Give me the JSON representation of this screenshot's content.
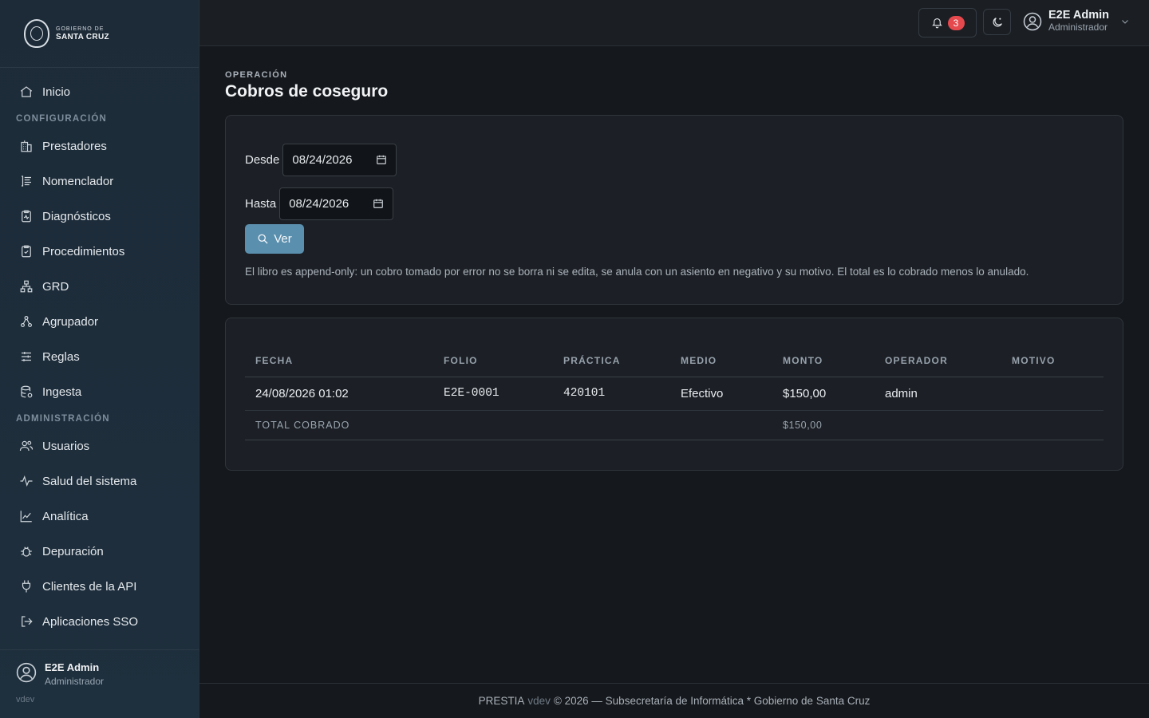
{
  "brand": {
    "line1": "GOBIERNO DE",
    "line2": "SANTA CRUZ"
  },
  "sidebar": {
    "home": {
      "label": "Inicio",
      "icon": "house-icon"
    },
    "config_title": "CONFIGURACIÓN",
    "config_items": [
      {
        "label": "Prestadores",
        "icon": "building-icon"
      },
      {
        "label": "Nomenclador",
        "icon": "list-icon"
      },
      {
        "label": "Diagnósticos",
        "icon": "clipboard-pulse-icon"
      },
      {
        "label": "Procedimientos",
        "icon": "clipboard-check-icon"
      },
      {
        "label": "GRD",
        "icon": "network-icon"
      },
      {
        "label": "Agrupador",
        "icon": "hierarchy-icon"
      },
      {
        "label": "Reglas",
        "icon": "sliders-icon"
      },
      {
        "label": "Ingesta",
        "icon": "database-icon"
      }
    ],
    "admin_title": "ADMINISTRACIÓN",
    "admin_items": [
      {
        "label": "Usuarios",
        "icon": "users-icon"
      },
      {
        "label": "Salud del sistema",
        "icon": "activity-icon"
      },
      {
        "label": "Analítica",
        "icon": "chart-line-icon"
      },
      {
        "label": "Depuración",
        "icon": "bug-icon"
      },
      {
        "label": "Clientes de la API",
        "icon": "plug-icon"
      },
      {
        "label": "Aplicaciones SSO",
        "icon": "login-icon"
      }
    ],
    "user": {
      "name": "E2E Admin",
      "role": "Administrador"
    },
    "version": "vdev"
  },
  "topbar": {
    "notifications_count": "3",
    "user": {
      "name": "E2E Admin",
      "role": "Administrador"
    }
  },
  "page": {
    "eyebrow": "OPERACIÓN",
    "title": "Cobros de coseguro"
  },
  "filters": {
    "desde_label": "Desde",
    "desde_value": "08/24/2026",
    "hasta_label": "Hasta",
    "hasta_value": "08/24/2026",
    "ver_label": "Ver",
    "note": "El libro es append-only: un cobro tomado por error no se borra ni se edita, se anula con un asiento en negativo y su motivo. El total es lo cobrado menos lo anulado."
  },
  "table": {
    "headers": [
      "FECHA",
      "FOLIO",
      "PRÁCTICA",
      "MEDIO",
      "MONTO",
      "OPERADOR",
      "MOTIVO"
    ],
    "rows": [
      {
        "fecha": "24/08/2026 01:02",
        "folio": "E2E-0001",
        "practica": "420101",
        "medio": "Efectivo",
        "monto": "$150,00",
        "operador": "admin",
        "motivo": ""
      }
    ],
    "total_label": "TOTAL COBRADO",
    "total_value": "$150,00"
  },
  "footer": {
    "app": "PRESTIA",
    "version": "vdev",
    "rest": "© 2026 — Subsecretaría de Informática * Gobierno de Santa Cruz"
  }
}
